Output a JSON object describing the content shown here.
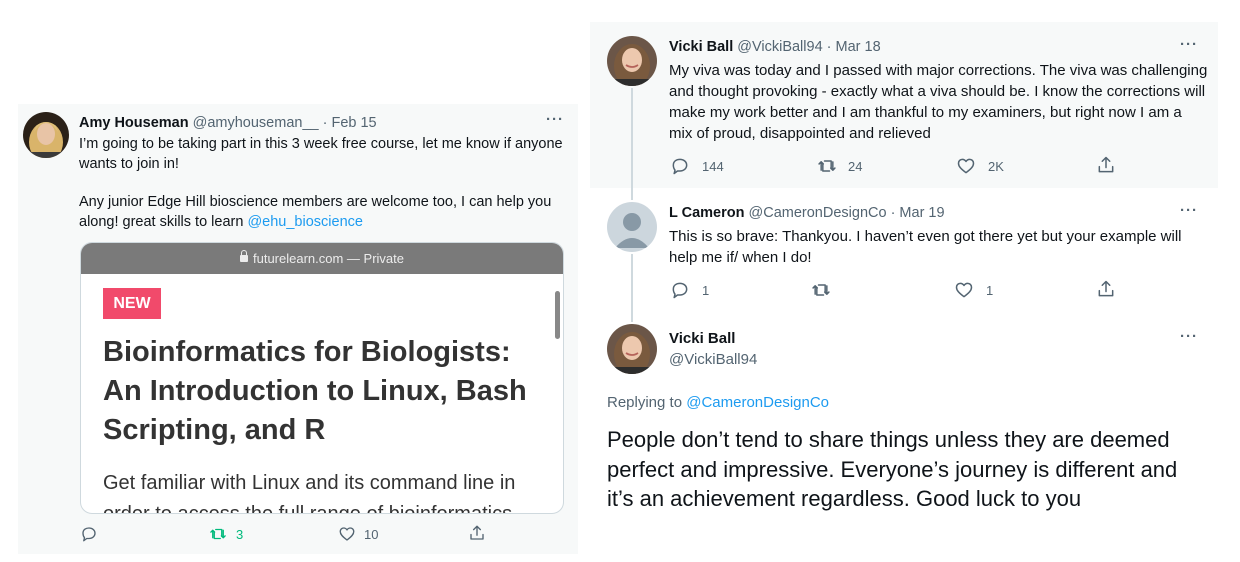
{
  "left_tweet": {
    "author_name": "Amy Houseman",
    "author_handle": "@amyhouseman__",
    "date": "· Feb 15",
    "more": "···",
    "text_line1": "I’m going to be taking part in this 3 week free course, let me know if anyone wants to join in!",
    "text_line2_prefix": "Any junior Edge Hill bioscience members are welcome too, I can help you along! great skills to learn ",
    "mention": "@ehu_bioscience",
    "preview": {
      "url": "futurelearn.com — Private",
      "badge": "NEW",
      "title": "Bioinformatics for Biologists: An Introduction to Linux, Bash Scripting, and R",
      "description": "Get familiar with Linux and its command line in order to access the full range of bioinformatics"
    },
    "actions": {
      "reply_count": "",
      "retweet_count": "3",
      "like_count": "10"
    },
    "colors": {
      "retweet_active": "#00ba7c",
      "badge": "#f14a6b"
    }
  },
  "thread": {
    "tweet1": {
      "author_name": "Vicki Ball",
      "author_handle": "@VickiBall94",
      "date": "· Mar 18",
      "more": "···",
      "text": "My viva was today and I passed with major corrections. The viva was challenging and thought provoking - exactly what a viva should be. I know the corrections will make my work better and I am thankful to my examiners, but right now I am a mix of proud, disappointed and relieved",
      "reply_count": "144",
      "retweet_count": "24",
      "like_count": "2K"
    },
    "tweet2": {
      "author_name": "L Cameron",
      "author_handle": "@CameronDesignCo",
      "date": "· Mar 19",
      "more": "···",
      "text": "This is so brave: Thankyou. I haven’t even got there yet but your example will help me if/ when I do!",
      "reply_count": "1",
      "retweet_count": "",
      "like_count": "1"
    },
    "tweet3": {
      "author_name": "Vicki Ball",
      "author_handle": "@VickiBall94",
      "more": "···",
      "replying_prefix": "Replying to ",
      "replying_to": "@CameronDesignCo",
      "text": "People don’t tend to share things unless they are deemed perfect and impressive. Everyone’s journey is different and it’s an achievement regardless. Good luck to you"
    }
  }
}
